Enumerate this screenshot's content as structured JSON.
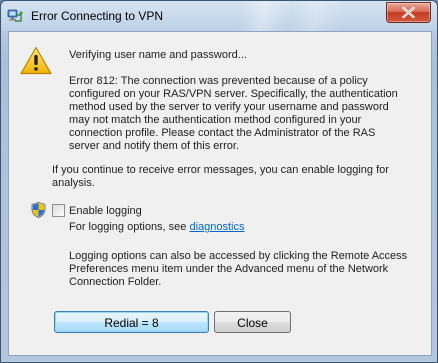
{
  "window": {
    "title": "Error Connecting to VPN"
  },
  "message": {
    "status": "Verifying user name and password...",
    "error_lines": [
      "Error 812: The connection was prevented because of a policy",
      "configured on your RAS/VPN server. Specifically, the authentication",
      "method used by the server to verify your username and password",
      "may not match the authentication method configured in your",
      "connection profile. Please contact the Administrator of the RAS",
      "server and notify them of this error."
    ],
    "continue_lines": [
      "If you continue to receive error messages, you can enable logging for",
      "analysis."
    ]
  },
  "logging": {
    "checkbox_label": "Enable logging",
    "checked": false,
    "hint_prefix": "For logging options, see ",
    "hint_link": "diagnostics",
    "info_lines": [
      "Logging options can also be accessed by clicking the Remote Access",
      "Preferences menu item under the Advanced menu of the Network",
      "Connection Folder."
    ]
  },
  "buttons": {
    "redial_label": "Redial = 8",
    "close_label": "Close"
  },
  "icons": {
    "app": "network-connection-icon",
    "warning": "warning-icon",
    "uac": "uac-shield-icon",
    "close": "close-icon"
  },
  "colors": {
    "link": "#0066cc",
    "warning_yellow": "#f7c81c",
    "close_red": "#c43c22"
  }
}
